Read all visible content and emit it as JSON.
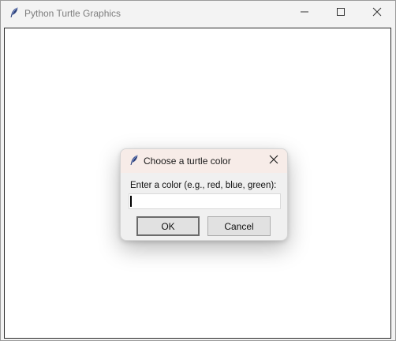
{
  "window": {
    "title": "Python Turtle Graphics",
    "icon": "feather-icon"
  },
  "dialog": {
    "title": "Choose a turtle color",
    "icon": "feather-icon",
    "prompt": "Enter a color (e.g., red, blue, green):",
    "input_value": "",
    "ok_label": "OK",
    "cancel_label": "Cancel"
  },
  "colors": {
    "window_bg": "#f3f3f3",
    "canvas_bg": "#ffffff",
    "dialog_bg": "#f0f0f0",
    "dialog_titlebar_bg": "#f7ece8"
  }
}
